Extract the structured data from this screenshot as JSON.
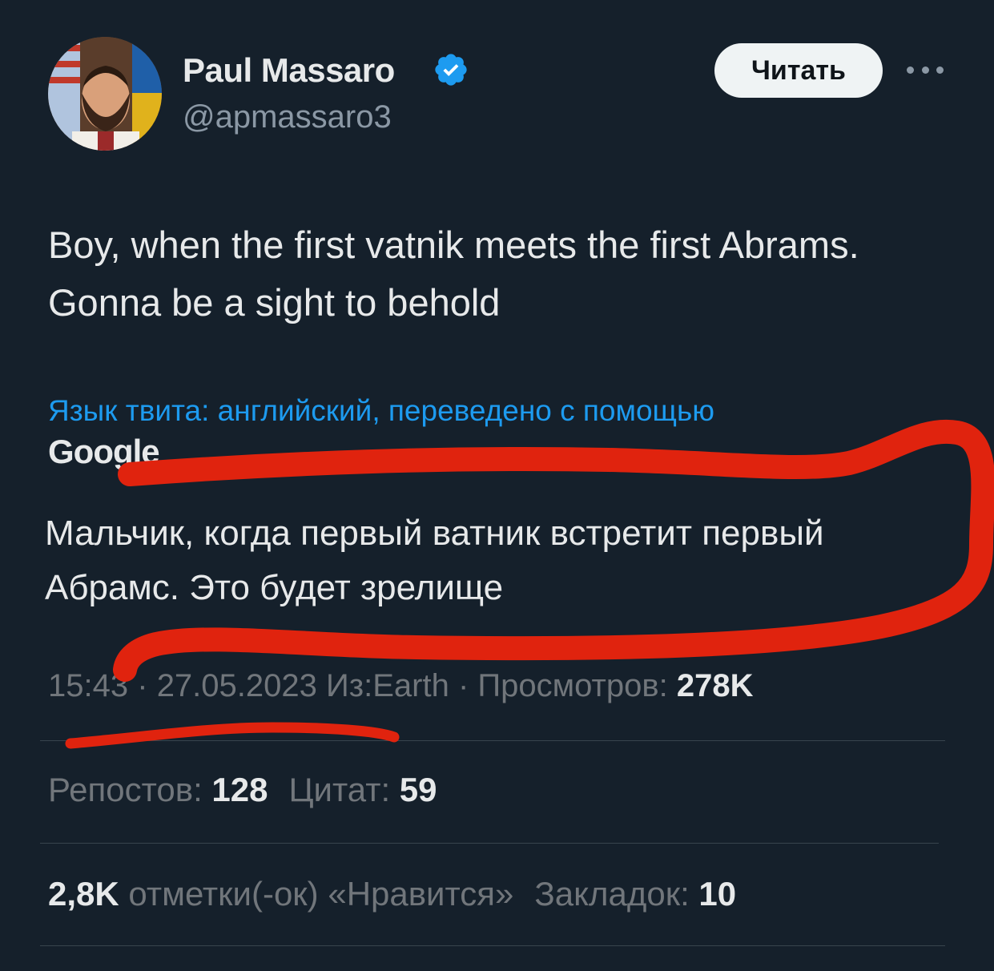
{
  "author": {
    "name": "Paul Massaro",
    "handle": "@apmassaro3",
    "verified": true
  },
  "follow_button": "Читать",
  "more_icon": "more-horizontal-icon",
  "tweet": {
    "text": "Boy, when the first vatnik meets the first Abrams. Gonna be a sight to behold",
    "translation_note": "Язык твита: английский, переведено с помощью",
    "translation_provider": "Google",
    "translation": "Мальчик, когда первый ватник встретит первый Абрамс. Это будет зрелище"
  },
  "meta": {
    "time": "15:43",
    "separator": "·",
    "date": "27.05.2023",
    "source": "Из:Earth",
    "views_label": "Просмотров:",
    "views_value": "278K"
  },
  "stats": {
    "reposts_label": "Репостов:",
    "reposts_value": "128",
    "quotes_label": "Цитат:",
    "quotes_value": "59",
    "likes_value": "2,8K",
    "likes_label": "отметки(-ок) «Нравится»",
    "bookmarks_label": "Закладок:",
    "bookmarks_value": "10"
  },
  "colors": {
    "background": "#15202b",
    "text": "#e7e9ea",
    "secondary": "#71767b",
    "link": "#1d9bf0",
    "verified": "#1d9bf0",
    "annotation": "#e0230e"
  }
}
